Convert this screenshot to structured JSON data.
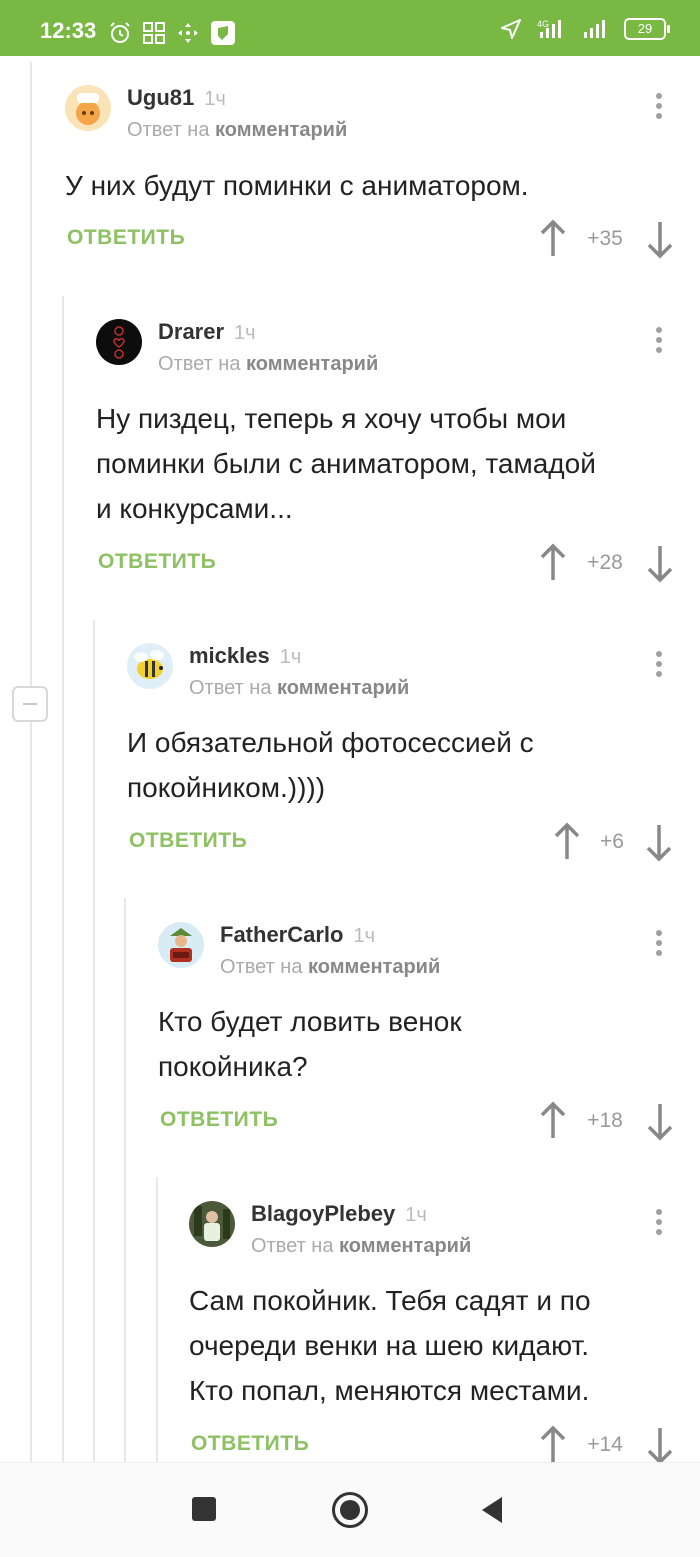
{
  "status_bar": {
    "time": "12:33",
    "network": "4G",
    "battery": "29"
  },
  "comments": [
    {
      "author": "Ugu81",
      "time": "1ч",
      "reply_prefix": "Ответ на",
      "reply_target": "комментарий",
      "text_lines": [
        "У них будут поминки с аниматором."
      ],
      "reply_label": "ОТВЕТИТЬ",
      "score": "+35"
    },
    {
      "author": "Drarer",
      "time": "1ч",
      "reply_prefix": "Ответ на",
      "reply_target": "комментарий",
      "text_lines": [
        "Ну пиздец, теперь я хочу чтобы мои",
        "поминки были с аниматором, тамадой",
        "и конкурсами..."
      ],
      "reply_label": "ОТВЕТИТЬ",
      "score": "+28"
    },
    {
      "author": "mickles",
      "time": "1ч",
      "reply_prefix": "Ответ на",
      "reply_target": "комментарий",
      "text_lines": [
        "И обязательной фотосессией с",
        "покойником.))))"
      ],
      "reply_label": "ОТВЕТИТЬ",
      "score": "+6"
    },
    {
      "author": "FatherCarlo",
      "time": "1ч",
      "reply_prefix": "Ответ на",
      "reply_target": "комментарий",
      "text_lines": [
        "Кто будет ловить венок",
        "покойника?"
      ],
      "reply_label": "ОТВЕТИТЬ",
      "score": "+18"
    },
    {
      "author": "BlagoyPlebey",
      "time": "1ч",
      "reply_prefix": "Ответ на",
      "reply_target": "комментарий",
      "text_lines": [
        "Сам покойник. Тебя садят и по",
        "очереди венки на шею кидают.",
        "Кто попал, меняются местами."
      ],
      "reply_label": "ОТВЕТИТЬ",
      "score": "+14"
    }
  ],
  "colors": {
    "accent": "#78b843",
    "reply_button": "#8dc164"
  },
  "icons": {
    "upvote": "arrow-up-icon",
    "downvote": "arrow-down-icon",
    "menu": "more-vertical-icon",
    "collapse": "minus-icon"
  }
}
